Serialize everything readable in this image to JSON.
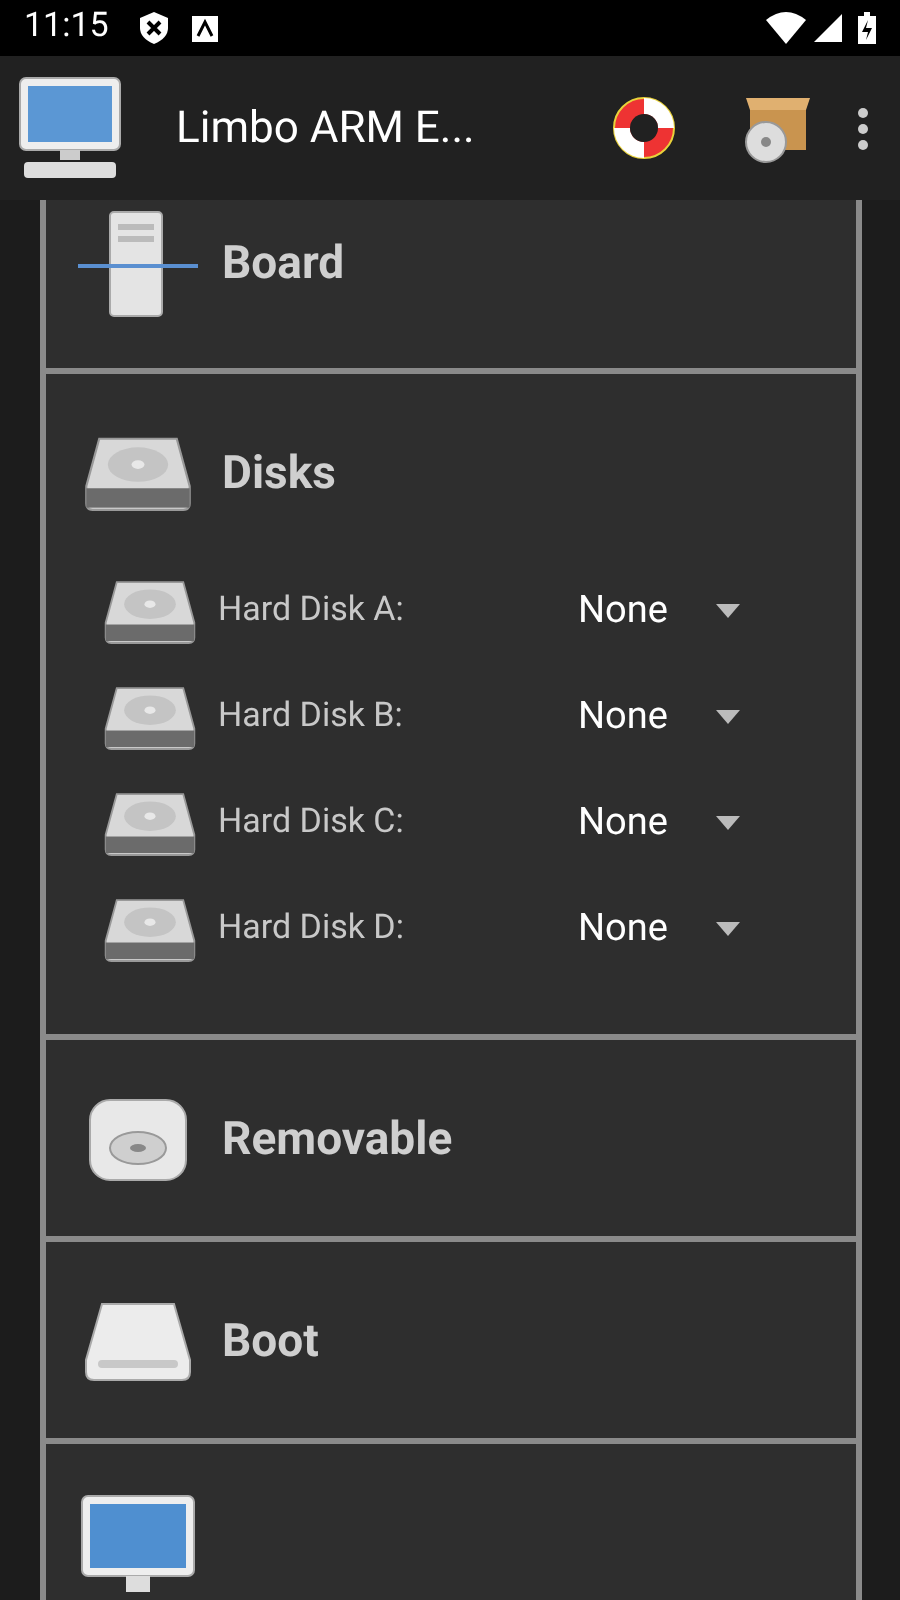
{
  "status_bar": {
    "time": "11:15"
  },
  "app_bar": {
    "title": "Limbo ARM E..."
  },
  "sections": [
    {
      "kind": "board",
      "title": "Board"
    },
    {
      "kind": "disks",
      "title": "Disks",
      "rows": [
        {
          "label": "Hard Disk A:",
          "value": "None"
        },
        {
          "label": "Hard Disk B:",
          "value": "None"
        },
        {
          "label": "Hard Disk C:",
          "value": "None"
        },
        {
          "label": "Hard Disk D:",
          "value": "None"
        }
      ]
    },
    {
      "kind": "removable",
      "title": "Removable"
    },
    {
      "kind": "boot",
      "title": "Boot"
    },
    {
      "kind": "display"
    }
  ]
}
